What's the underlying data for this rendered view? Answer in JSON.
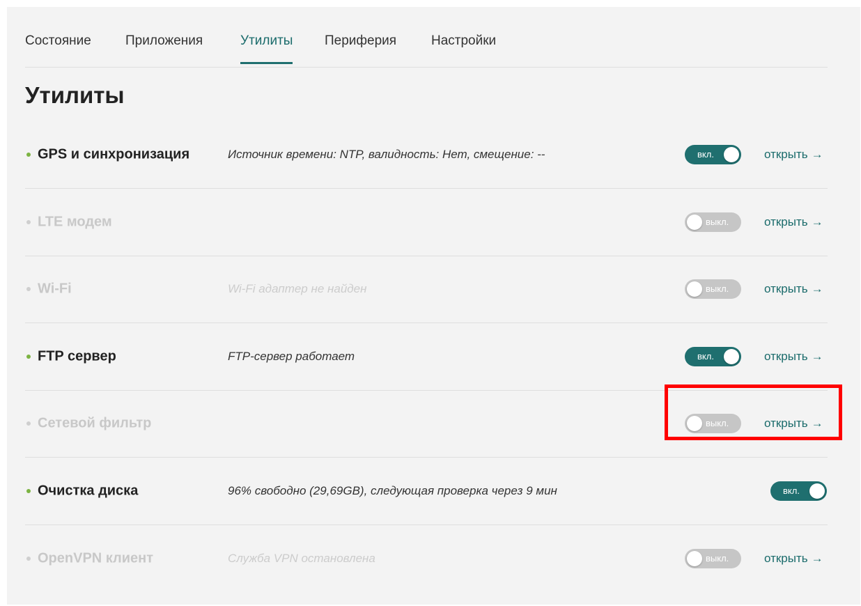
{
  "tabs": [
    {
      "label": "Состояние",
      "active": false
    },
    {
      "label": "Приложения",
      "active": false
    },
    {
      "label": "Утилиты",
      "active": true
    },
    {
      "label": "Периферия",
      "active": false
    },
    {
      "label": "Настройки",
      "active": false
    }
  ],
  "page_title": "Утилиты",
  "open_label": "открыть",
  "arrow_icon": "→",
  "toggle_on_label": "вкл.",
  "toggle_off_label": "выкл.",
  "utilities": [
    {
      "name": "GPS и синхронизация",
      "desc": "Источник времени: NTP, валидность: Нет, смещение: --",
      "enabled": true
    },
    {
      "name": "LTE модем",
      "desc": "",
      "enabled": false
    },
    {
      "name": "Wi-Fi",
      "desc": "Wi-Fi адаптер не найден",
      "enabled": false
    },
    {
      "name": "FTP сервер",
      "desc": "FTP-сервер работает",
      "enabled": true
    },
    {
      "name": "Сетевой фильтр",
      "desc": "",
      "enabled": false
    },
    {
      "name": "Очистка диска",
      "desc": "96% свободно (29,69GB), следующая проверка через 9 мин",
      "enabled": true
    },
    {
      "name": "OpenVPN клиент",
      "desc": "Служба VPN остановлена",
      "enabled": false
    }
  ],
  "colors": {
    "accent": "#1f6f6f",
    "status_dot_active": "#7cb342",
    "highlight_box": "#ff0000"
  }
}
